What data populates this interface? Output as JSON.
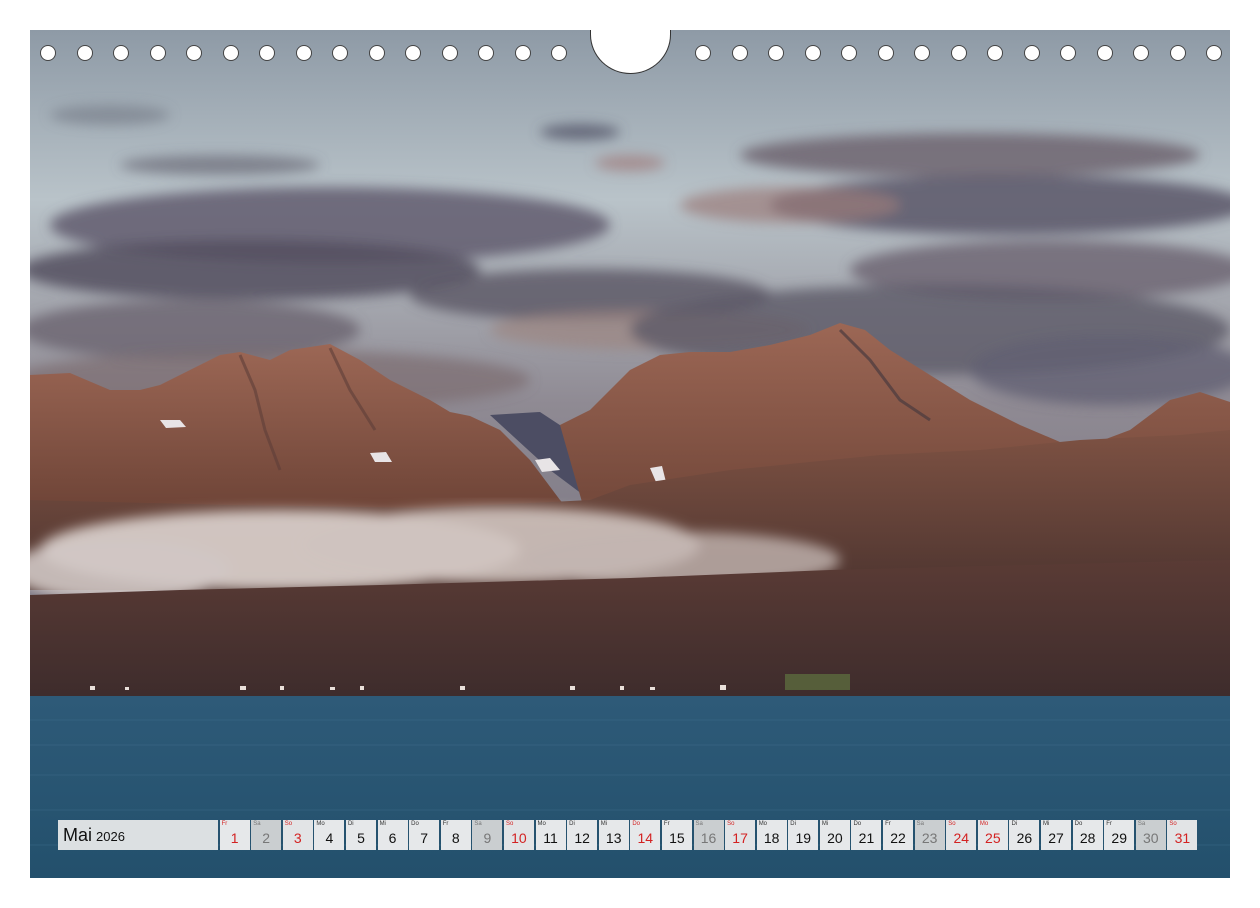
{
  "calendar": {
    "month": "Mai",
    "year": "2026",
    "days": [
      {
        "n": "1",
        "dow": "Fr",
        "type": "hol"
      },
      {
        "n": "2",
        "dow": "Sa",
        "type": "sat"
      },
      {
        "n": "3",
        "dow": "So",
        "type": "sun"
      },
      {
        "n": "4",
        "dow": "Mo",
        "type": "wk"
      },
      {
        "n": "5",
        "dow": "Di",
        "type": "wk"
      },
      {
        "n": "6",
        "dow": "Mi",
        "type": "wk"
      },
      {
        "n": "7",
        "dow": "Do",
        "type": "wk"
      },
      {
        "n": "8",
        "dow": "Fr",
        "type": "wk"
      },
      {
        "n": "9",
        "dow": "Sa",
        "type": "sat"
      },
      {
        "n": "10",
        "dow": "So",
        "type": "sun"
      },
      {
        "n": "11",
        "dow": "Mo",
        "type": "wk"
      },
      {
        "n": "12",
        "dow": "Di",
        "type": "wk"
      },
      {
        "n": "13",
        "dow": "Mi",
        "type": "wk"
      },
      {
        "n": "14",
        "dow": "Do",
        "type": "hol"
      },
      {
        "n": "15",
        "dow": "Fr",
        "type": "wk"
      },
      {
        "n": "16",
        "dow": "Sa",
        "type": "sat"
      },
      {
        "n": "17",
        "dow": "So",
        "type": "sun"
      },
      {
        "n": "18",
        "dow": "Mo",
        "type": "wk"
      },
      {
        "n": "19",
        "dow": "Di",
        "type": "wk"
      },
      {
        "n": "20",
        "dow": "Mi",
        "type": "wk"
      },
      {
        "n": "21",
        "dow": "Do",
        "type": "wk"
      },
      {
        "n": "22",
        "dow": "Fr",
        "type": "wk"
      },
      {
        "n": "23",
        "dow": "Sa",
        "type": "sat"
      },
      {
        "n": "24",
        "dow": "So",
        "type": "sun"
      },
      {
        "n": "25",
        "dow": "Mo",
        "type": "hol"
      },
      {
        "n": "26",
        "dow": "Di",
        "type": "wk"
      },
      {
        "n": "27",
        "dow": "Mi",
        "type": "wk"
      },
      {
        "n": "28",
        "dow": "Do",
        "type": "wk"
      },
      {
        "n": "29",
        "dow": "Fr",
        "type": "wk"
      },
      {
        "n": "30",
        "dow": "Sa",
        "type": "sat"
      },
      {
        "n": "31",
        "dow": "So",
        "type": "sun"
      }
    ]
  },
  "colors": {
    "sunday_red": "#d32222",
    "saturday_grey": "#777777",
    "sea_blue": "#2f5a75",
    "mountain_rust": "#8a5747"
  }
}
